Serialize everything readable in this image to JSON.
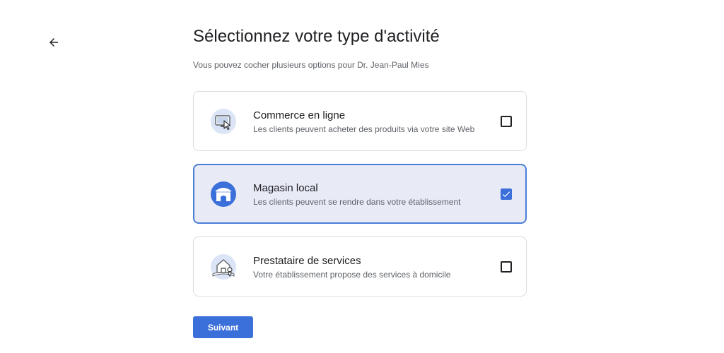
{
  "header": {
    "back_icon": "arrow-left-icon",
    "title": "Sélectionnez votre type d'activité",
    "subtitle": "Vous pouvez cocher plusieurs options pour Dr. Jean-Paul Mies"
  },
  "options": [
    {
      "title": "Commerce en ligne",
      "description": "Les clients peuvent acheter des produits via votre site Web",
      "icon": "monitor-cursor-icon",
      "checked": false
    },
    {
      "title": "Magasin local",
      "description": "Les clients peuvent se rendre dans votre établissement",
      "icon": "storefront-icon",
      "checked": true
    },
    {
      "title": "Prestataire de services",
      "description": "Votre établissement propose des services à domicile",
      "icon": "house-location-icon",
      "checked": false
    }
  ],
  "footer": {
    "next_label": "Suivant"
  },
  "colors": {
    "accent": "#3b6fd9",
    "selected_bg": "#e8eaf6",
    "selected_border": "#4a7fd6",
    "icon_bg": "#dbe5f7"
  }
}
